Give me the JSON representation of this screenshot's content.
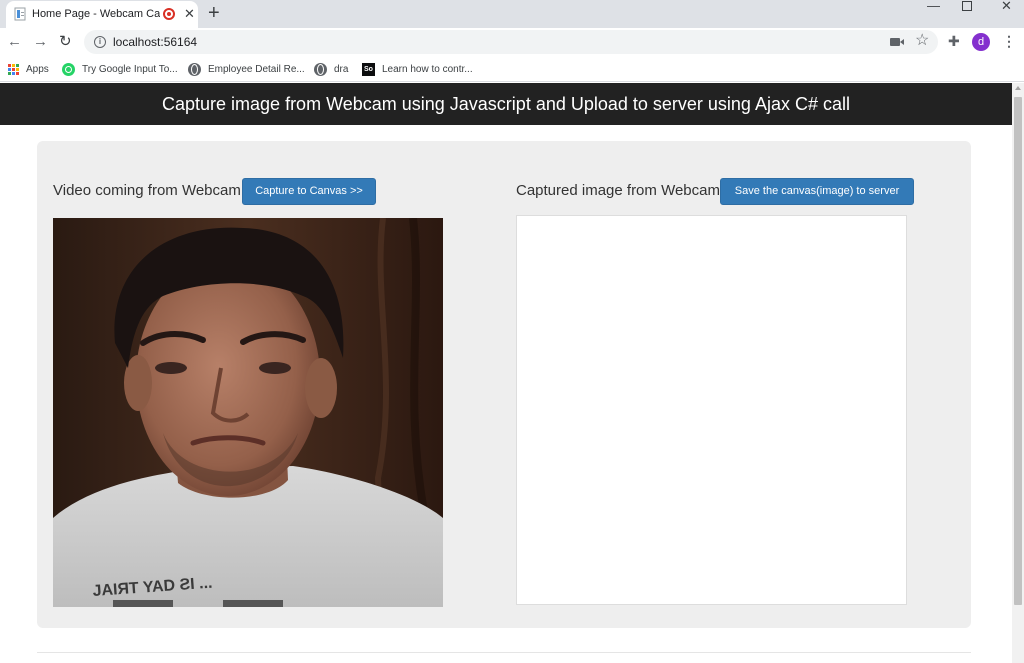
{
  "browser": {
    "tab_title": "Home Page - Webcam Captu",
    "url": "localhost:56164",
    "avatar_letter": "d",
    "bookmarks": [
      {
        "label": "Apps",
        "icon": "apps-grid-icon"
      },
      {
        "label": "Try Google Input To...",
        "icon": "whatsapp-icon"
      },
      {
        "label": "Employee Detail Re...",
        "icon": "globe-icon"
      },
      {
        "label": "dra",
        "icon": "globe-icon"
      },
      {
        "label": "Learn how to contr...",
        "icon": "stackoverflow-icon",
        "icon_text": "So"
      }
    ]
  },
  "page": {
    "header_title": "Capture image from Webcam using Javascript and Upload to server using Ajax C# call",
    "video_label": "Video coming from Webcam",
    "capture_button": "Capture to Canvas >>",
    "canvas_label": "Captured image from Webcam",
    "save_button": "Save the canvas(image) to server"
  },
  "colors": {
    "header_bg": "#222222",
    "primary_button": "#337ab7",
    "jumbotron_bg": "#eeeeee",
    "avatar": "#8430ce"
  }
}
